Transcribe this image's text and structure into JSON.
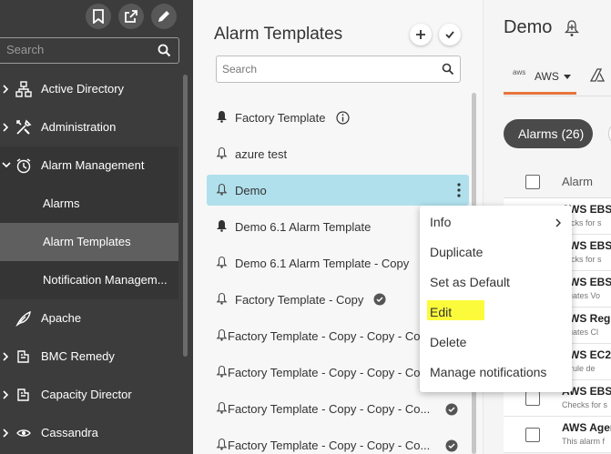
{
  "nav": {
    "top_buttons": [
      "bookmark-icon",
      "external-link-icon",
      "edit-pencil-icon"
    ],
    "search_placeholder": "Search",
    "items": [
      {
        "label": "Active Directory",
        "icon": "network-icon"
      },
      {
        "label": "Administration",
        "icon": "tools-icon"
      },
      {
        "label": "Alarm Management",
        "icon": "alarm-clock-icon"
      },
      {
        "label": "Apache",
        "icon": "feather-icon"
      },
      {
        "label": "BMC Remedy",
        "icon": "plugin-icon"
      },
      {
        "label": "Capacity Director",
        "icon": "plugin-icon"
      },
      {
        "label": "Cassandra",
        "icon": "eye-icon"
      }
    ],
    "sub_items": [
      {
        "label": "Alarms"
      },
      {
        "label": "Alarm Templates"
      },
      {
        "label": "Notification Managem..."
      }
    ]
  },
  "templates": {
    "title": "Alarm Templates",
    "search_placeholder": "Search",
    "items": [
      {
        "label": "Factory Template",
        "bell": "filled",
        "badge": "info"
      },
      {
        "label": "azure test",
        "bell": "outline",
        "badge": ""
      },
      {
        "label": "Demo",
        "bell": "outline",
        "badge": "",
        "selected": true
      },
      {
        "label": "Demo 6.1 Alarm Template",
        "bell": "filled",
        "badge": ""
      },
      {
        "label": "Demo 6.1 Alarm Template - Copy",
        "bell": "outline",
        "badge": ""
      },
      {
        "label": "Factory Template - Copy",
        "bell": "outline",
        "badge": "check"
      },
      {
        "label": "Factory Template - Copy - Copy - Co",
        "bell": "outline",
        "badge": ""
      },
      {
        "label": "Factory Template - Copy - Copy - Co",
        "bell": "outline",
        "badge": ""
      },
      {
        "label": "Factory Template - Copy - Copy - Co...",
        "bell": "outline",
        "badge": "check"
      },
      {
        "label": "Factory Template - Copy - Copy - Co...",
        "bell": "outline",
        "badge": "check"
      }
    ]
  },
  "main": {
    "title": "Demo",
    "tab_aws_logo": "aws",
    "tab_aws_label": "AWS",
    "alarms_pill": "Alarms (26)",
    "column_alarm": "Alarm",
    "rows": [
      {
        "name": "AWS EBS V",
        "desc": "hecks for s"
      },
      {
        "name": "AWS EBS V",
        "desc": "hecks for s"
      },
      {
        "name": "AWS EBS V",
        "desc": "aluates Vo"
      },
      {
        "name": "AWS Regi",
        "desc": "aluates Cl"
      },
      {
        "name": "AWS EC2 I",
        "desc": "is rule de"
      },
      {
        "name": "AWS EBS V",
        "desc": "Checks for s"
      },
      {
        "name": "AWS Agen",
        "desc": "This alarm f"
      }
    ]
  },
  "context_menu": {
    "items": [
      {
        "label": "Info",
        "submenu": true
      },
      {
        "label": "Duplicate"
      },
      {
        "label": "Set as Default"
      },
      {
        "label": "Edit",
        "highlighted": true
      },
      {
        "label": "Delete"
      },
      {
        "label": "Manage notifications"
      }
    ],
    "highlight_color": "#fbfb3c"
  },
  "colors": {
    "nav_bg": "#3c3c3c",
    "selected_row": "#b0e0ec",
    "aws_tab_accent": "#e8743b"
  }
}
